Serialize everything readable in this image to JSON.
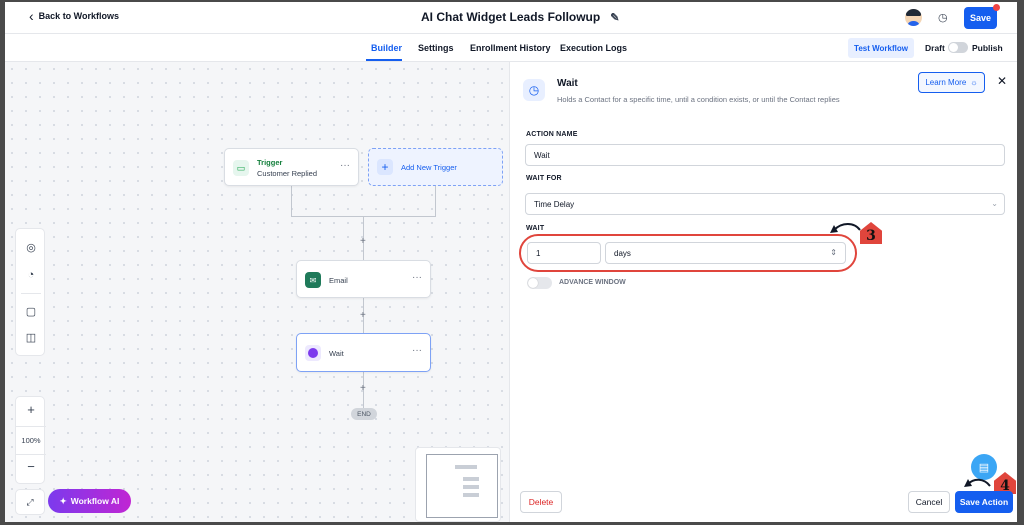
{
  "header": {
    "back_label": "Back to Workflows",
    "title": "AI Chat Widget Leads Followup",
    "save_label": "Save"
  },
  "tabs": [
    {
      "label": "Builder",
      "active": true
    },
    {
      "label": "Settings",
      "active": false
    },
    {
      "label": "Enrollment History",
      "active": false
    },
    {
      "label": "Execution Logs",
      "active": false
    }
  ],
  "toolbar": {
    "test_label": "Test Workflow",
    "draft_label": "Draft",
    "publish_label": "Publish",
    "published": false
  },
  "canvas": {
    "trigger": {
      "title": "Trigger",
      "subtitle": "Customer Replied"
    },
    "add_trigger_label": "Add New Trigger",
    "email_label": "Email",
    "wait_label": "Wait",
    "end_label": "END",
    "zoom_level": "100%",
    "workflow_ai_label": "Workflow AI"
  },
  "panel": {
    "title": "Wait",
    "description": "Holds a Contact for a specific time, until a condition exists, or until the Contact replies",
    "learn_more_label": "Learn More",
    "action_name_label": "ACTION NAME",
    "action_name_value": "Wait",
    "wait_for_label": "WAIT FOR",
    "wait_for_value": "Time Delay",
    "wait_label": "WAIT",
    "wait_amount": "1",
    "wait_unit": "days",
    "advance_window_label": "ADVANCE WINDOW",
    "advance_window_enabled": false,
    "delete_label": "Delete",
    "cancel_label": "Cancel",
    "save_action_label": "Save Action"
  },
  "annotations": {
    "step3": "3",
    "step4": "4",
    "color": "#e0453c"
  },
  "colors": {
    "primary": "#155eef",
    "danger": "#dc2626"
  }
}
